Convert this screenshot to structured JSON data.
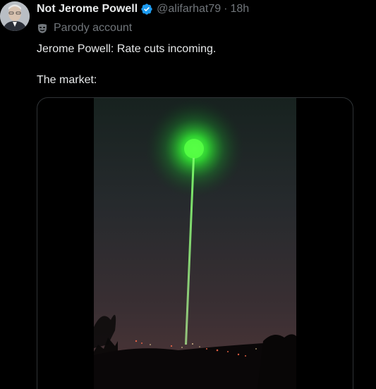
{
  "author": {
    "display_name": "Not Jerome Powell",
    "handle": "@alifarhat79",
    "separator": "·",
    "time": "18h",
    "verified_icon": "verified-badge-icon",
    "label_icon": "parody-mask-icon",
    "label": "Parody account"
  },
  "tweet": {
    "line1": "Jerome Powell: Rate cuts incoming.",
    "line2": "The market:"
  },
  "media": {
    "type": "video",
    "icon": "green-laser-beam"
  },
  "colors": {
    "background": "#000000",
    "primary_text": "#e7e9ea",
    "secondary_text": "#71767b",
    "verified_blue": "#1d9bf0",
    "laser_green": "#33ff33"
  }
}
